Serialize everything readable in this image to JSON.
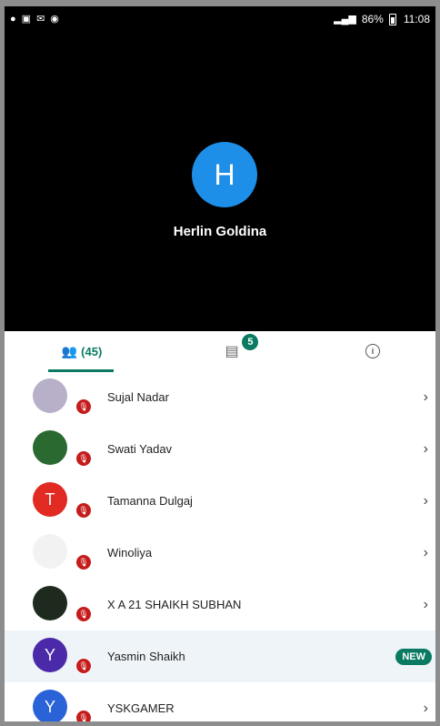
{
  "status_bar": {
    "signal": "4G",
    "battery": "86%",
    "time": "11:08"
  },
  "call": {
    "caller_initial": "H",
    "caller_name": "Herlin Goldina",
    "avatar_color": "#1e8fe8"
  },
  "tabs": {
    "people_label": "(45)",
    "chat_badge": "5"
  },
  "participants": [
    {
      "name": "Sujal Nadar",
      "avatar_type": "photo",
      "color": "#b8b0c8",
      "trail": "chevron"
    },
    {
      "name": "Swati Yadav",
      "avatar_type": "photo",
      "color": "#2a6a30",
      "trail": "chevron"
    },
    {
      "name": "Tamanna Dulgaj",
      "initial": "T",
      "avatar_type": "initial",
      "color": "#e02a22",
      "trail": "chevron"
    },
    {
      "name": "Winoliya",
      "avatar_type": "photo",
      "color": "#f2f2f2",
      "trail": "chevron"
    },
    {
      "name": "X A 21 SHAIKH SUBHAN",
      "avatar_type": "photo",
      "color": "#1d2a1d",
      "trail": "chevron"
    },
    {
      "name": "Yasmin Shaikh",
      "initial": "Y",
      "avatar_type": "initial",
      "color": "#4a2aa8",
      "trail": "new",
      "badge": "NEW"
    },
    {
      "name": "YSKGAMER",
      "initial": "Y",
      "avatar_type": "initial",
      "color": "#2a62d8",
      "trail": "chevron"
    }
  ],
  "accent_color": "#0b7a63",
  "mute_color": "#c61b1b"
}
